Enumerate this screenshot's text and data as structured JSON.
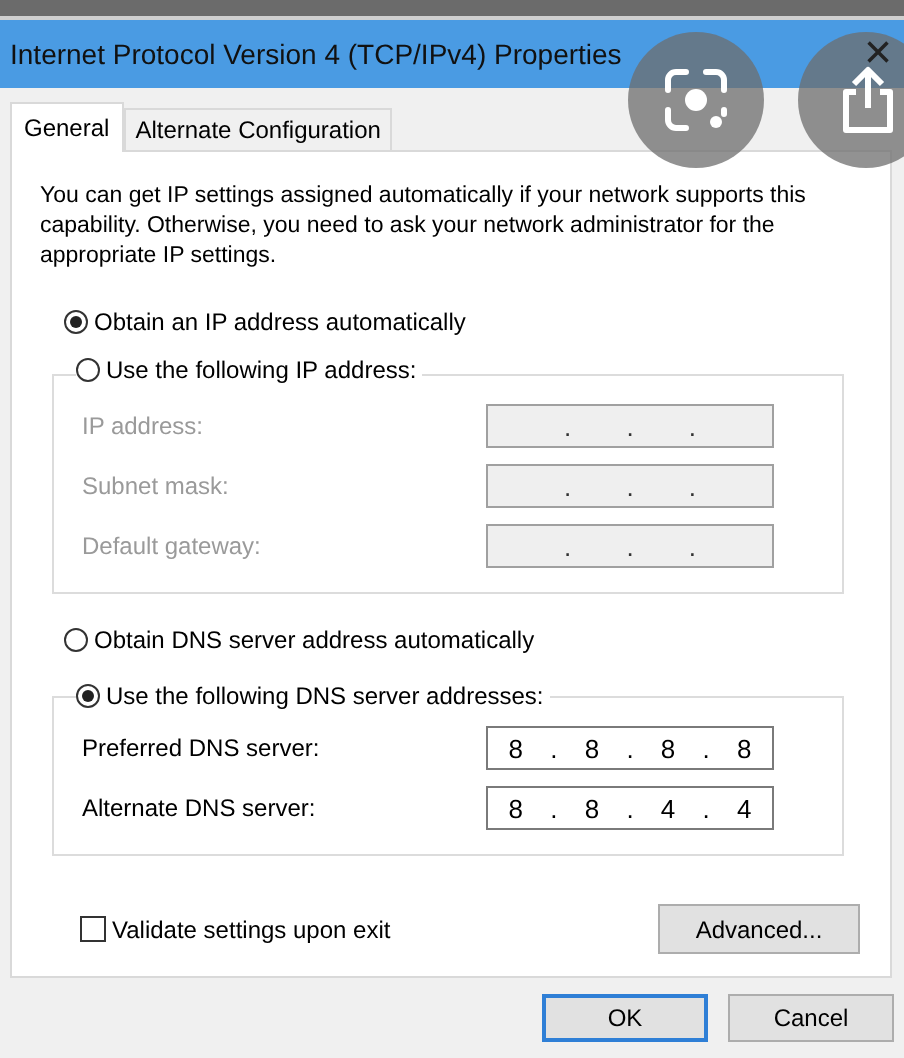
{
  "window": {
    "title": "Internet Protocol Version 4 (TCP/IPv4) Properties",
    "close": "×"
  },
  "tabs": [
    {
      "label": "General",
      "selected": true
    },
    {
      "label": "Alternate Configuration",
      "selected": false
    }
  ],
  "intro": "You can get IP settings assigned automatically if your network supports this capability. Otherwise, you need to ask your network administrator for the appropriate IP settings.",
  "ip_auto": {
    "label": "Obtain an IP address automatically",
    "selected": true
  },
  "ip_manual": {
    "label": "Use the following IP address:",
    "selected": false,
    "disabled": true,
    "fields": [
      {
        "label": "IP address:",
        "value": ". . ."
      },
      {
        "label": "Subnet mask:",
        "value": ". . ."
      },
      {
        "label": "Default gateway:",
        "value": ". . ."
      }
    ]
  },
  "dns_auto": {
    "label": "Obtain DNS server address automatically",
    "selected": false
  },
  "dns_manual": {
    "label": "Use the following DNS server addresses:",
    "selected": true,
    "disabled": false,
    "fields": [
      {
        "label": "Preferred DNS server:",
        "value": "8 . 8 . 8 . 8"
      },
      {
        "label": "Alternate DNS server:",
        "value": "8 . 8 . 4 . 4"
      }
    ]
  },
  "validate": {
    "label": "Validate settings upon exit",
    "checked": false
  },
  "advanced_button": "Advanced...",
  "buttons": [
    {
      "label": "OK",
      "default": true
    },
    {
      "label": "Cancel",
      "default": false
    }
  ]
}
